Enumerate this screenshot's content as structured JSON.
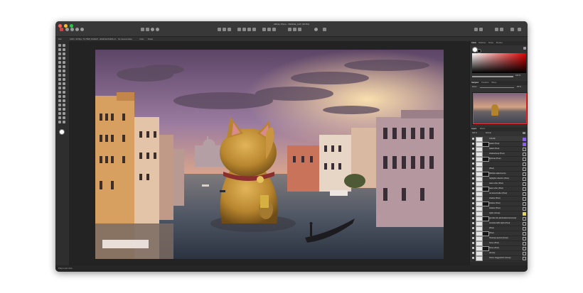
{
  "window": {
    "title": "Affinity Photo - VENICE_CAT (38.8%)",
    "traffic_colors": [
      "#ff5f57",
      "#febc2e",
      "#28c840"
    ]
  },
  "context_bar": {
    "items": [
      "Pan",
      "3125 × 3079px, 76.75MP, RGBA/8 - sRGB IEC61966-2.1",
      "No Camera Data",
      "Units:",
      "Pixels"
    ]
  },
  "panel": {
    "colour_tabs": [
      "Colour",
      "Swatches",
      "Stroke",
      "Brushes"
    ],
    "opacity_value": "100 %",
    "nav_tabs": [
      "Navigator",
      "Transform",
      "History"
    ],
    "zoom_label": "Zoom",
    "zoom_value": "39 %",
    "layers_tabs": [
      "Layers",
      "Effects"
    ],
    "layers_opacity": "100 %",
    "blend_mode": "Normal",
    "layers": [
      {
        "name": "COLOR",
        "color_badge": "#8a5cf0"
      },
      {
        "name": "splash (Pixel)",
        "color_badge": "#8a5cf0"
      },
      {
        "name": "splash (Pixel)",
        "color_badge": ""
      },
      {
        "name": "shadow/wrap (Pixel)",
        "color_badge": ""
      },
      {
        "name": "lightmap (Pixel)",
        "color_badge": ""
      },
      {
        "name": "",
        "color_badge": ""
      },
      {
        "name": "(Pixel)",
        "color_badge": ""
      },
      {
        "name": "(Multiple adjustments)",
        "color_badge": ""
      },
      {
        "name": "highlights reflection (Pixel)",
        "color_badge": ""
      },
      {
        "name": "water reflex (Pixel)",
        "color_badge": ""
      },
      {
        "name": "water reflex (Pixel)",
        "color_badge": ""
      },
      {
        "name": "cat lantern/reflex (Pixel)",
        "color_badge": ""
      },
      {
        "name": "shadow (Pixel)",
        "color_badge": ""
      },
      {
        "name": "shadow (Pixel)",
        "color_badge": ""
      },
      {
        "name": "shadow (Pixel)",
        "color_badge": ""
      },
      {
        "name": "Lights (Group)",
        "color_badge": "#e8d44d"
      },
      {
        "name": "gondola ride (Embedded document)",
        "color_badge": ""
      },
      {
        "name": "Gondola traffic lights (Pixel)",
        "color_badge": ""
      },
      {
        "name": "(Pixel)",
        "color_badge": ""
      },
      {
        "name": "(Pixel)",
        "color_badge": ""
      },
      {
        "name": "Housing Layouts (Group)",
        "color_badge": ""
      },
      {
        "name": "house (Pixel)",
        "color_badge": ""
      },
      {
        "name": "house (Pixel)",
        "color_badge": ""
      },
      {
        "name": "(Group)",
        "color_badge": ""
      },
      {
        "name": "Venice Guggenheim (Group)",
        "color_badge": ""
      }
    ]
  },
  "status": {
    "text": "Drag to pan view."
  }
}
